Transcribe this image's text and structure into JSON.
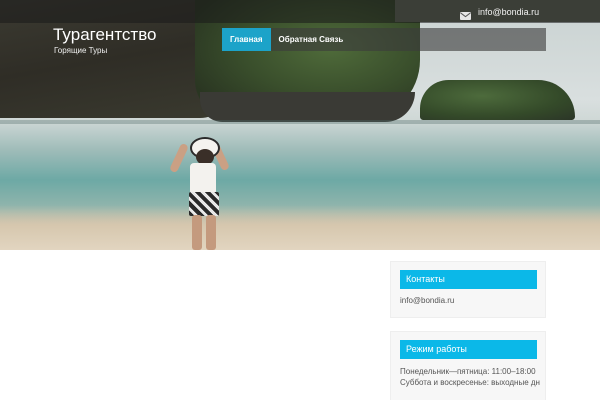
{
  "topbar": {
    "email": "info@bondia.ru",
    "mail_icon": "envelope-icon"
  },
  "site": {
    "title": "Турагентство",
    "tagline": "Горящие Туры"
  },
  "nav": {
    "items": [
      {
        "label": "Главная",
        "active": true
      },
      {
        "label": "Обратная Связь",
        "active": false
      }
    ]
  },
  "colors": {
    "accent": "#1ca3c9",
    "widget_title": "#0bb8e8"
  },
  "sidebar": {
    "contacts": {
      "title": "Контакты",
      "email": "info@bondia.ru"
    },
    "hours": {
      "title": "Режим работы",
      "line1": "Понедельник—пятница: 11:00–18:00",
      "line2": "Суббота и воскресенье: выходные дн"
    }
  }
}
